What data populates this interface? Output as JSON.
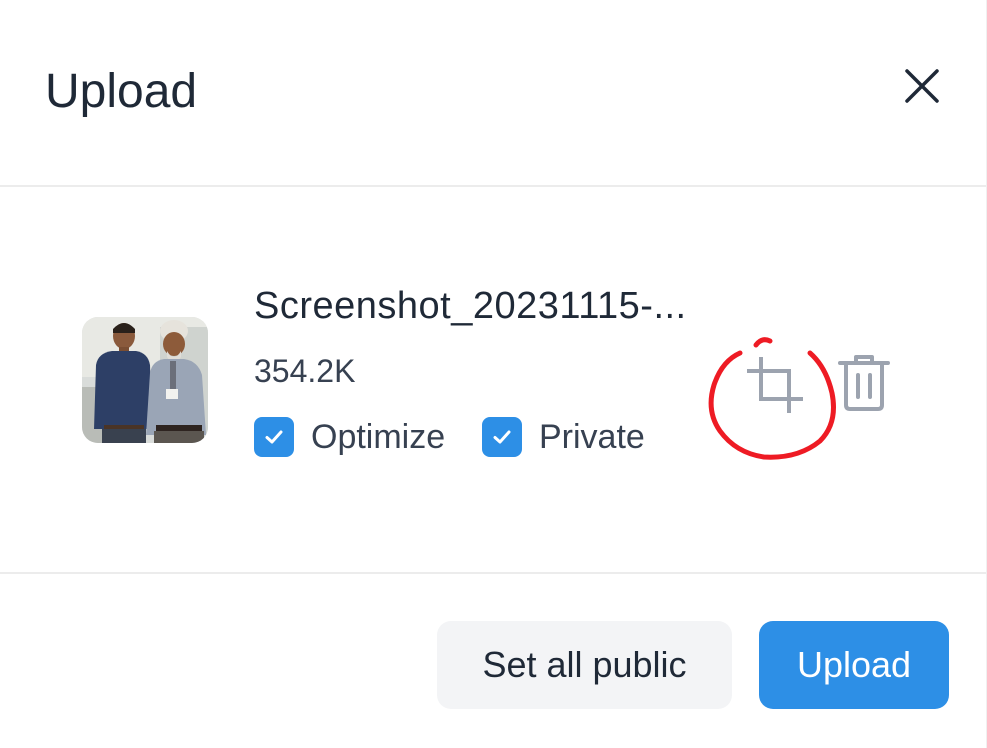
{
  "dialog": {
    "title": "Upload"
  },
  "file": {
    "name": "Screenshot_20231115-...",
    "size": "354.2K",
    "options": [
      {
        "label": "Optimize",
        "checked": true
      },
      {
        "label": "Private",
        "checked": true
      }
    ],
    "actions": {
      "crop_icon": "crop-icon",
      "delete_icon": "trash-icon"
    }
  },
  "footer": {
    "secondary_label": "Set all public",
    "primary_label": "Upload"
  },
  "colors": {
    "accent": "#2d8fe6",
    "annotation": "#ee1b24",
    "secondary_button_bg": "#f3f4f6"
  }
}
